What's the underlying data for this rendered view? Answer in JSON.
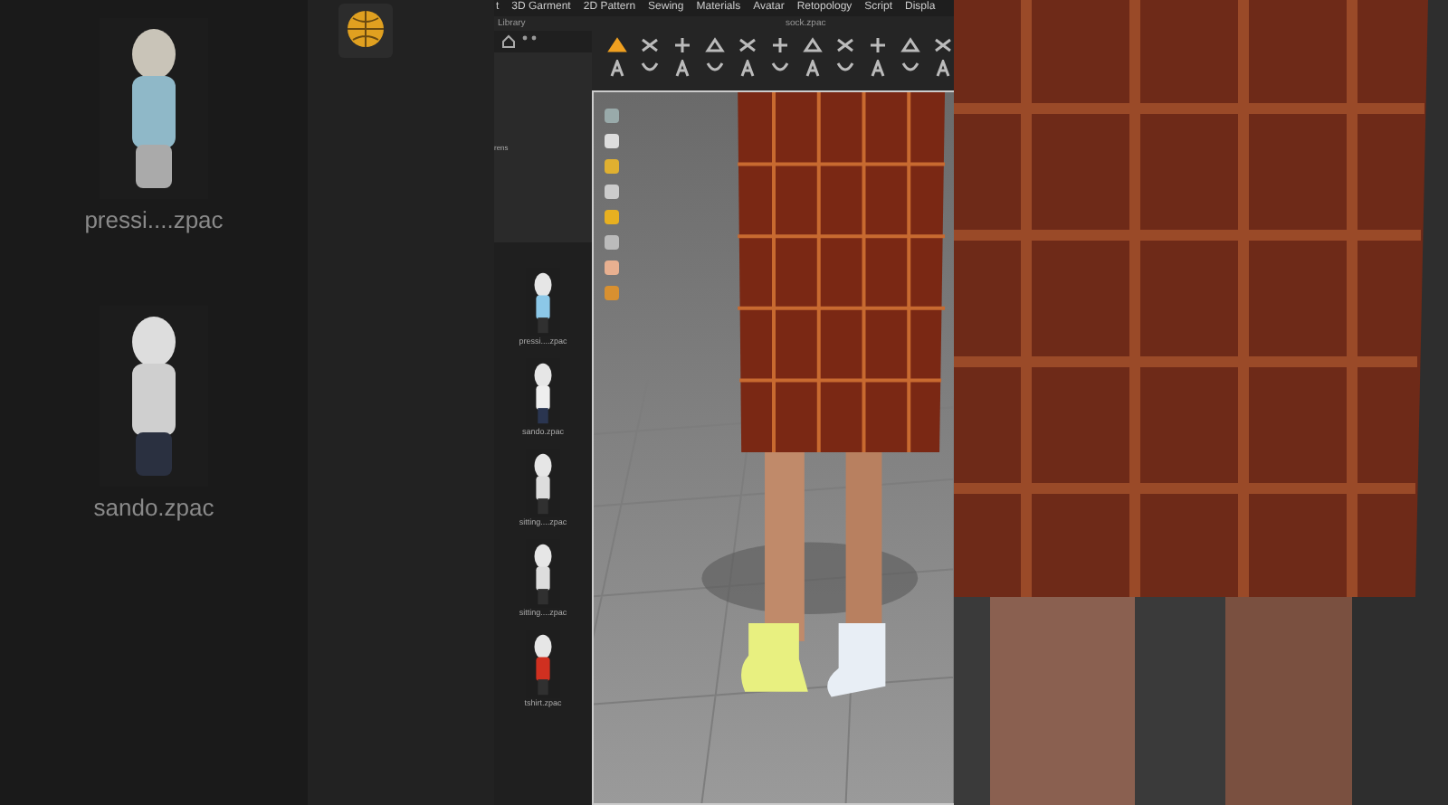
{
  "background_labels": [
    "pressi....zpac",
    "sando.zpac"
  ],
  "menu": [
    "t",
    "3D Garment",
    "2D Pattern",
    "Sewing",
    "Materials",
    "Avatar",
    "Retopology",
    "Script",
    "Displa"
  ],
  "library_label": "Library",
  "document_title": "sock.zpac",
  "side_label": "rens",
  "library_items": [
    {
      "label": "pressi....zpac"
    },
    {
      "label": "sando.zpac"
    },
    {
      "label": "sitting....zpac"
    },
    {
      "label": "sitting....zpac"
    },
    {
      "label": "tshirt.zpac"
    }
  ]
}
